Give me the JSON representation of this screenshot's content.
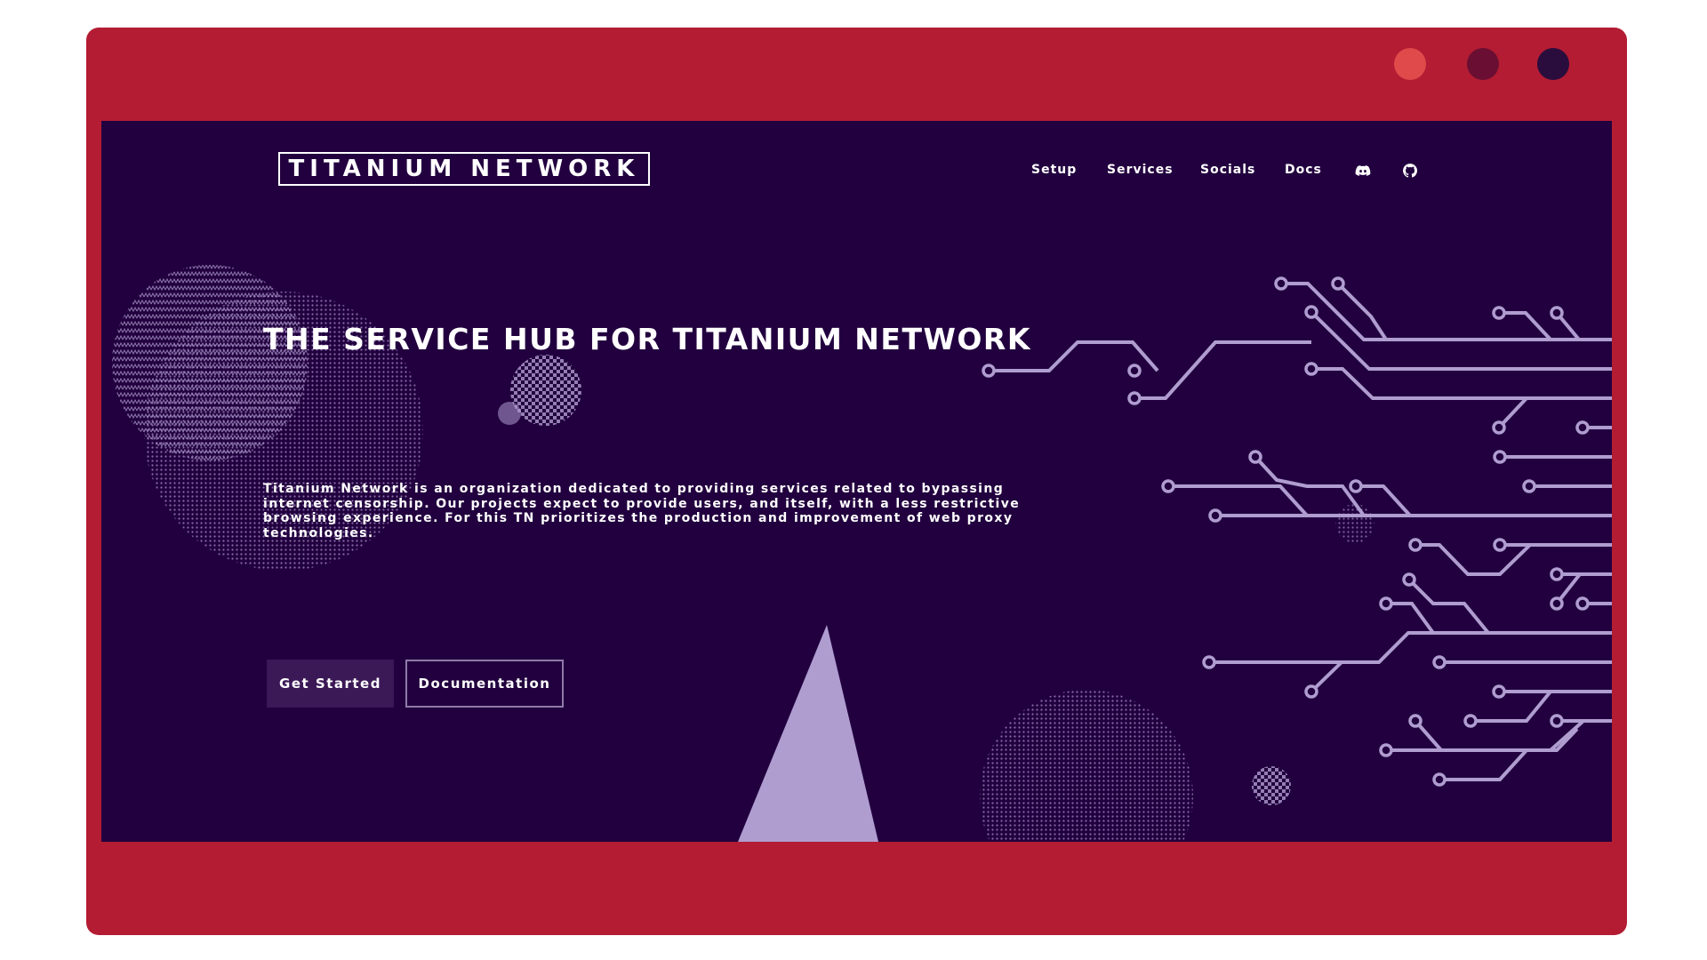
{
  "window": {
    "frame_color": "#b31c33",
    "dots": [
      {
        "name": "close-dot",
        "color": "#e04a4a"
      },
      {
        "name": "minimize-dot",
        "color": "#6a0f33"
      },
      {
        "name": "maximize-dot",
        "color": "#2a0d3d"
      }
    ]
  },
  "header": {
    "logo_text": "TITANIUM NETWORK",
    "nav": [
      {
        "label": "Setup"
      },
      {
        "label": "Services"
      },
      {
        "label": "Socials"
      },
      {
        "label": "Docs"
      }
    ],
    "icons": [
      {
        "name": "discord-icon"
      },
      {
        "name": "github-icon"
      }
    ]
  },
  "hero": {
    "title": "THE SERVICE HUB FOR TITANIUM NETWORK",
    "description": "Titanium Network is an organization dedicated to providing services related to bypassing internet censorship. Our projects expect to provide users, and itself, with a less restrictive browsing experience. For this TN prioritizes the production and improvement of web proxy technologies.",
    "buttons": {
      "primary": "Get Started",
      "secondary": "Documentation"
    }
  },
  "theme": {
    "background": "#22003f",
    "accent": "#b09dd0",
    "text": "#ffffff"
  }
}
